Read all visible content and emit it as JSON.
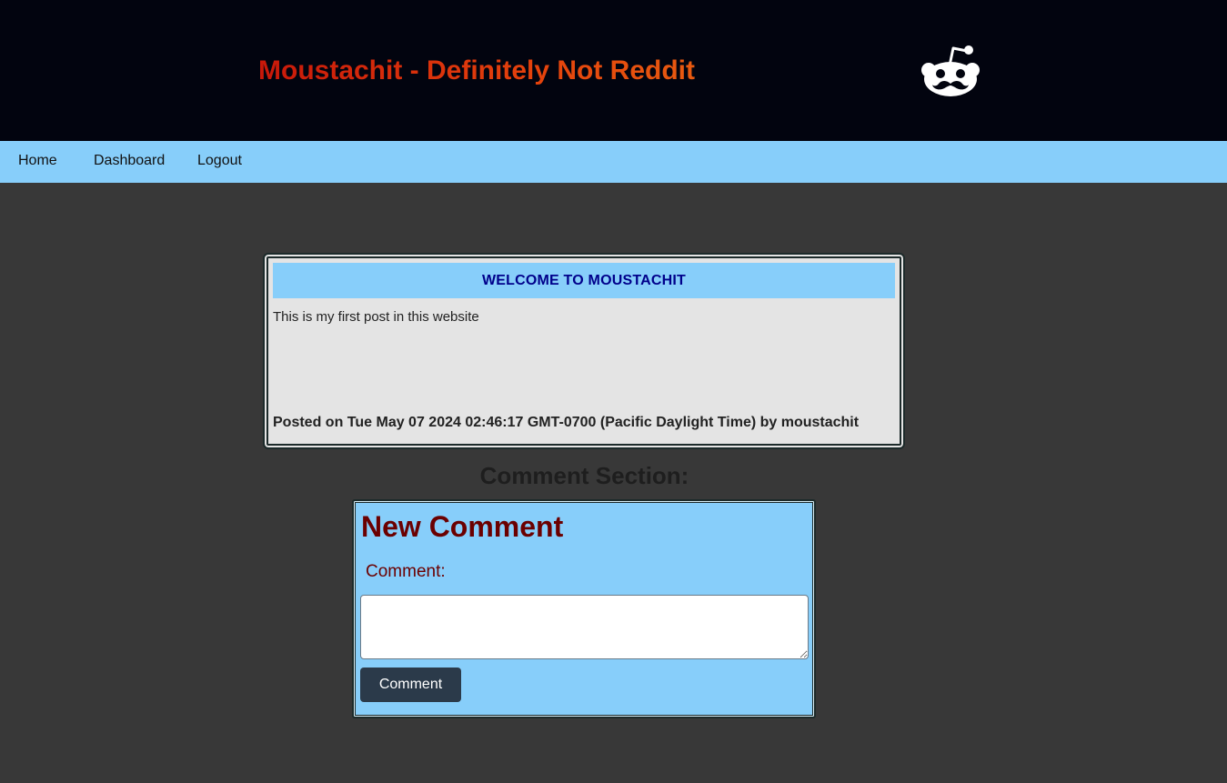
{
  "header": {
    "title": "Moustachit - Definitely Not Reddit",
    "logo_icon": "reddit-alien-moustache-icon",
    "title_color_start": "#c8180a",
    "title_color_end": "#e85a10",
    "background": "#02040f"
  },
  "nav": {
    "items": [
      {
        "label": "Home"
      },
      {
        "label": "Dashboard"
      },
      {
        "label": "Logout"
      }
    ],
    "background": "#87cefa"
  },
  "post": {
    "title": "WELCOME TO MOUSTACHIT",
    "content": "This is my first post in this website",
    "meta": "Posted on Tue May 07 2024 02:46:17 GMT-0700 (Pacific Daylight Time) by moustachit"
  },
  "comments": {
    "heading": "Comment Section:",
    "form": {
      "title": "New Comment",
      "label": "Comment:",
      "value": "",
      "submit_label": "Comment"
    }
  },
  "colors": {
    "page_background": "#383838",
    "accent_blue": "#87cefa",
    "post_title_text": "#00008b",
    "form_text": "#6b0000",
    "button_background": "#2b3a4a"
  }
}
